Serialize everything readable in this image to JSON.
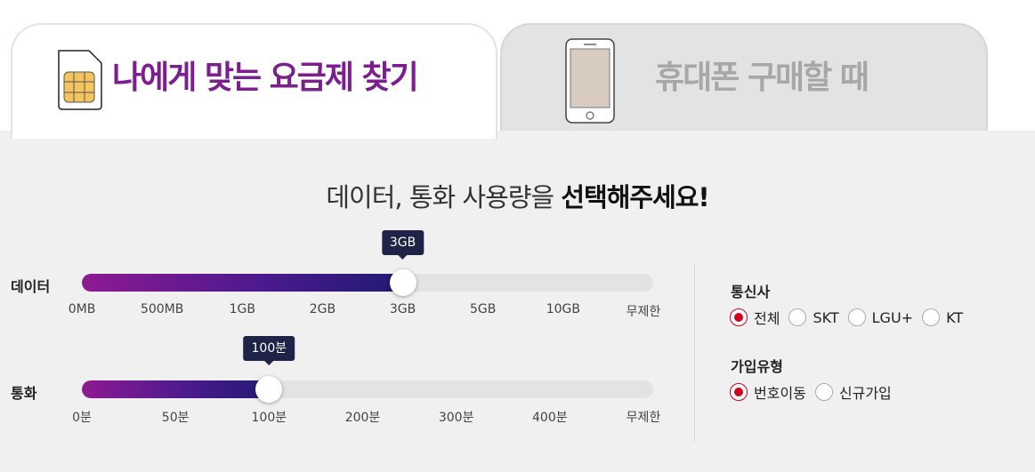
{
  "tabs": {
    "active": {
      "label": "나에게 맞는 요금제 찾기",
      "icon": "sim-card-icon"
    },
    "inactive": {
      "label": "휴대폰 구매할 때",
      "icon": "phone-icon"
    }
  },
  "headline": {
    "normal": "데이터, 통화 사용량을",
    "bold": "선택해주세요!"
  },
  "data_slider": {
    "label": "데이터",
    "ticks": [
      "0MB",
      "500MB",
      "1GB",
      "2GB",
      "3GB",
      "5GB",
      "10GB",
      "무제한"
    ],
    "selected": "3GB",
    "selected_index": 4
  },
  "call_slider": {
    "label": "통화",
    "ticks": [
      "0분",
      "50분",
      "100분",
      "200분",
      "300분",
      "400분",
      "무제한"
    ],
    "selected": "100분",
    "selected_index": 2
  },
  "carrier": {
    "title": "통신사",
    "options": [
      "전체",
      "SKT",
      "LGU+",
      "KT"
    ],
    "selected": "전체"
  },
  "join_type": {
    "title": "가입유형",
    "options": [
      "번호이동",
      "신규가입"
    ],
    "selected": "번호이동"
  },
  "colors": {
    "accent_purple": "#7b1f8f",
    "bubble_navy": "#1e2347",
    "radio_red": "#d0021b"
  }
}
